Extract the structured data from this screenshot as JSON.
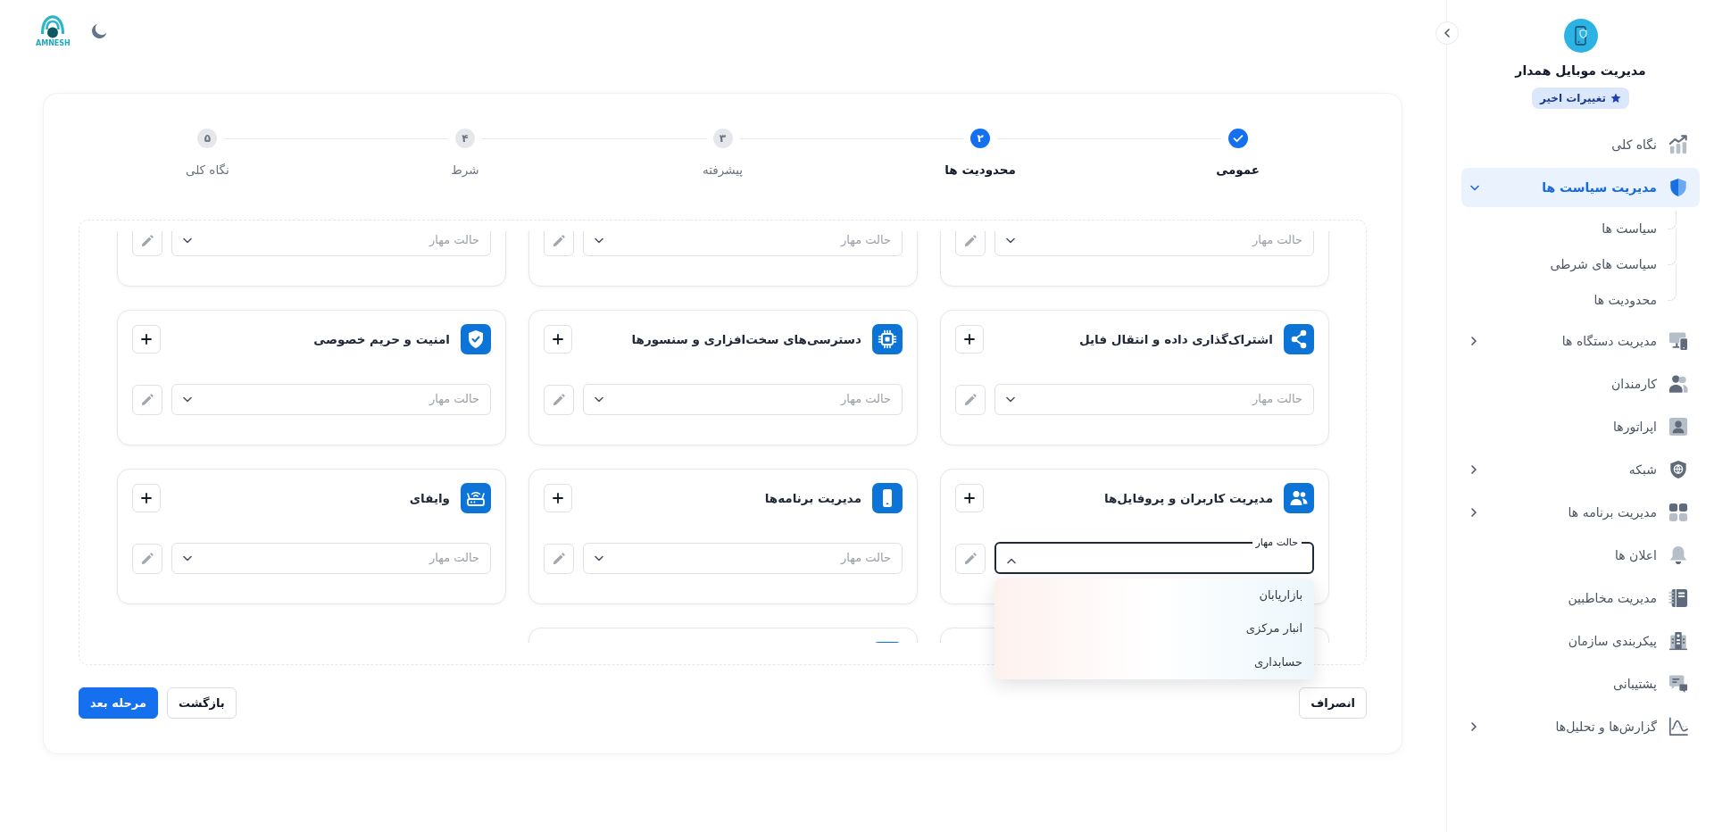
{
  "header": {
    "logo_text": "AMNESH"
  },
  "sidebar": {
    "title": "مدیریت موبایل همدار",
    "badge": "تغییرات اخیر",
    "items": [
      {
        "label": "نگاه کلی",
        "kind": "chart",
        "selected": false
      },
      {
        "label": "مدیریت سیاست ها",
        "kind": "shield",
        "selected": true,
        "expanded": true,
        "children": [
          {
            "label": "سیاست ها",
            "selected": false
          },
          {
            "label": "سیاست های شرطی",
            "selected": false
          },
          {
            "label": "محدودیت ها",
            "selected": false
          }
        ]
      },
      {
        "label": "مدیریت دستگاه ها",
        "kind": "devices",
        "selected": false,
        "expanded": false
      },
      {
        "label": "کارمندان",
        "kind": "users",
        "selected": false
      },
      {
        "label": "اپراتورها",
        "kind": "operator",
        "selected": false
      },
      {
        "label": "شبکه",
        "kind": "network",
        "selected": false,
        "expanded": false
      },
      {
        "label": "مدیریت برنامه ها",
        "kind": "apps",
        "selected": false,
        "expanded": false
      },
      {
        "label": "اعلان ها",
        "kind": "bell",
        "selected": false
      },
      {
        "label": "مدیریت مخاطبین",
        "kind": "contacts",
        "selected": false
      },
      {
        "label": "پیکربندی سازمان",
        "kind": "building",
        "selected": false
      },
      {
        "label": "پشتیبانی",
        "kind": "support",
        "selected": false
      },
      {
        "label": "گزارش‌ها و تحلیل‌ها",
        "kind": "reports",
        "selected": false,
        "expanded": false
      }
    ]
  },
  "steps": [
    {
      "label": "عمومی",
      "completed": true,
      "selected": false
    },
    {
      "number": "۲",
      "label": "محدودیت ها",
      "completed": false,
      "selected": true
    },
    {
      "number": "۳",
      "label": "پیشرفته",
      "completed": false,
      "selected": false
    },
    {
      "number": "۴",
      "label": "شرط",
      "completed": false,
      "selected": false
    },
    {
      "number": "۵",
      "label": "نگاه کلی",
      "completed": false,
      "selected": false
    }
  ],
  "policy_cards": [
    {
      "field": {
        "label": "حالت مهار",
        "expanded": false
      }
    },
    {
      "field": {
        "label": "حالت مهار",
        "expanded": false
      }
    },
    {
      "field": {
        "label": "حالت مهار",
        "expanded": false
      }
    },
    {
      "kind": "share",
      "title": "اشتراک‌گذاری داده و انتقال فایل",
      "field": {
        "label": "حالت مهار",
        "expanded": false
      }
    },
    {
      "kind": "chip",
      "title": "دسترسی‌های سخت‌افزاری و سنسورها",
      "field": {
        "label": "حالت مهار",
        "expanded": false
      }
    },
    {
      "kind": "shield",
      "title": "امنیت و حریم خصوصی",
      "field": {
        "label": "حالت مهار",
        "expanded": false
      }
    },
    {
      "kind": "users",
      "title": "مدیریت کاربران و پروفایل‌ها",
      "field": {
        "label": "حالت مهار",
        "expanded": true,
        "options": [
          {
            "label": "بازاریابان",
            "selected": false
          },
          {
            "label": "انبار مرکزی",
            "selected": false
          },
          {
            "label": "حسابداری",
            "selected": false
          }
        ]
      }
    },
    {
      "kind": "phone",
      "title": "مدیریت برنامه‌ها",
      "field": {
        "label": "حالت مهار",
        "expanded": false
      }
    },
    {
      "kind": "router",
      "title": "وایفای",
      "field": {
        "label": "حالت مهار",
        "expanded": false
      }
    },
    {
      "kind": "plain"
    },
    {
      "kind": "tile"
    }
  ],
  "footer": {
    "cancel": "انصراف",
    "buttons": [
      {
        "label": "بازگشت",
        "kind": "outline"
      },
      {
        "label": "مرحله بعد",
        "kind": "primary"
      }
    ]
  }
}
